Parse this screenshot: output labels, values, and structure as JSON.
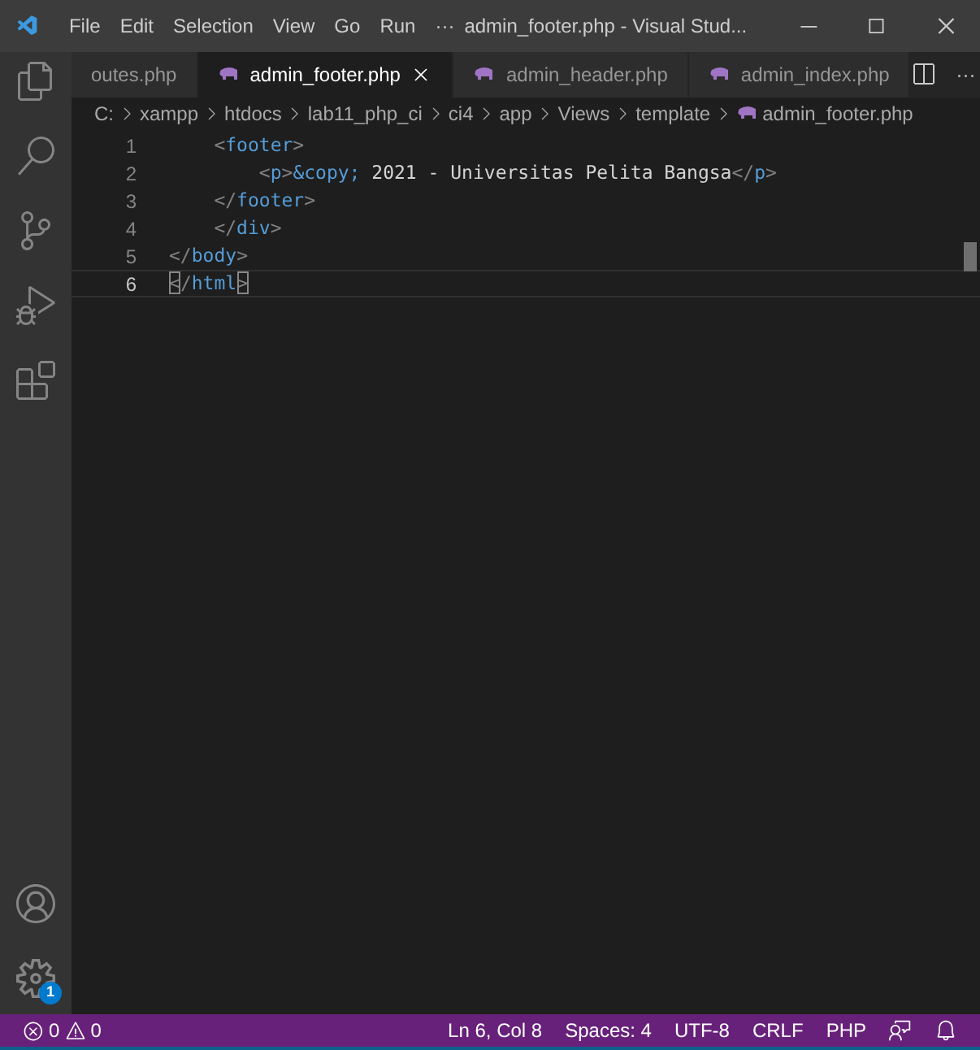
{
  "window": {
    "title": "admin_footer.php - Visual Stud..."
  },
  "menu": [
    "File",
    "Edit",
    "Selection",
    "View",
    "Go",
    "Run",
    "···"
  ],
  "tabs": [
    {
      "label": "outes.php",
      "selected": false,
      "php_icon": false
    },
    {
      "label": "admin_footer.php",
      "selected": true,
      "php_icon": true
    },
    {
      "label": "admin_header.php",
      "selected": false,
      "php_icon": true
    },
    {
      "label": "admin_index.php",
      "selected": false,
      "php_icon": true
    }
  ],
  "tab_actions": [
    "···"
  ],
  "breadcrumb": [
    "C:",
    "xampp",
    "htdocs",
    "lab11_php_ci",
    "ci4",
    "app",
    "Views",
    "template",
    "admin_footer.php"
  ],
  "lines": [
    {
      "number": "1",
      "current": false,
      "tokens": [
        {
          "text": "    <",
          "kind": "punct"
        },
        {
          "text": "footer",
          "kind": "tag"
        },
        {
          "text": ">",
          "kind": "punct"
        }
      ]
    },
    {
      "number": "2",
      "current": false,
      "tokens": [
        {
          "text": "        <",
          "kind": "punct"
        },
        {
          "text": "p",
          "kind": "tag"
        },
        {
          "text": ">",
          "kind": "punct"
        },
        {
          "text": "&copy;",
          "kind": "tag"
        },
        {
          "text": " 2021 - Universitas Pelita Bangsa",
          "kind": "text"
        },
        {
          "text": "</",
          "kind": "punct"
        },
        {
          "text": "p",
          "kind": "tag"
        },
        {
          "text": ">",
          "kind": "punct"
        }
      ]
    },
    {
      "number": "3",
      "current": false,
      "tokens": [
        {
          "text": "    </",
          "kind": "punct"
        },
        {
          "text": "footer",
          "kind": "tag"
        },
        {
          "text": ">",
          "kind": "punct"
        }
      ]
    },
    {
      "number": "4",
      "current": false,
      "tokens": [
        {
          "text": "    </",
          "kind": "punct"
        },
        {
          "text": "div",
          "kind": "tag"
        },
        {
          "text": ">",
          "kind": "punct"
        }
      ]
    },
    {
      "number": "5",
      "current": false,
      "tokens": [
        {
          "text": "</",
          "kind": "punct"
        },
        {
          "text": "body",
          "kind": "tag"
        },
        {
          "text": ">",
          "kind": "punct"
        }
      ]
    },
    {
      "number": "6",
      "current": true,
      "tokens": [
        {
          "text": "<",
          "kind": "match"
        },
        {
          "text": "/",
          "kind": "punct"
        },
        {
          "text": "html",
          "kind": "tag"
        },
        {
          "text": ">",
          "kind": "match"
        }
      ]
    }
  ],
  "activity_badge": "1",
  "status": {
    "errors": "0",
    "warnings": "0",
    "items": [
      "Ln 6, Col 8",
      "Spaces: 4",
      "UTF-8",
      "CRLF",
      "PHP"
    ]
  }
}
